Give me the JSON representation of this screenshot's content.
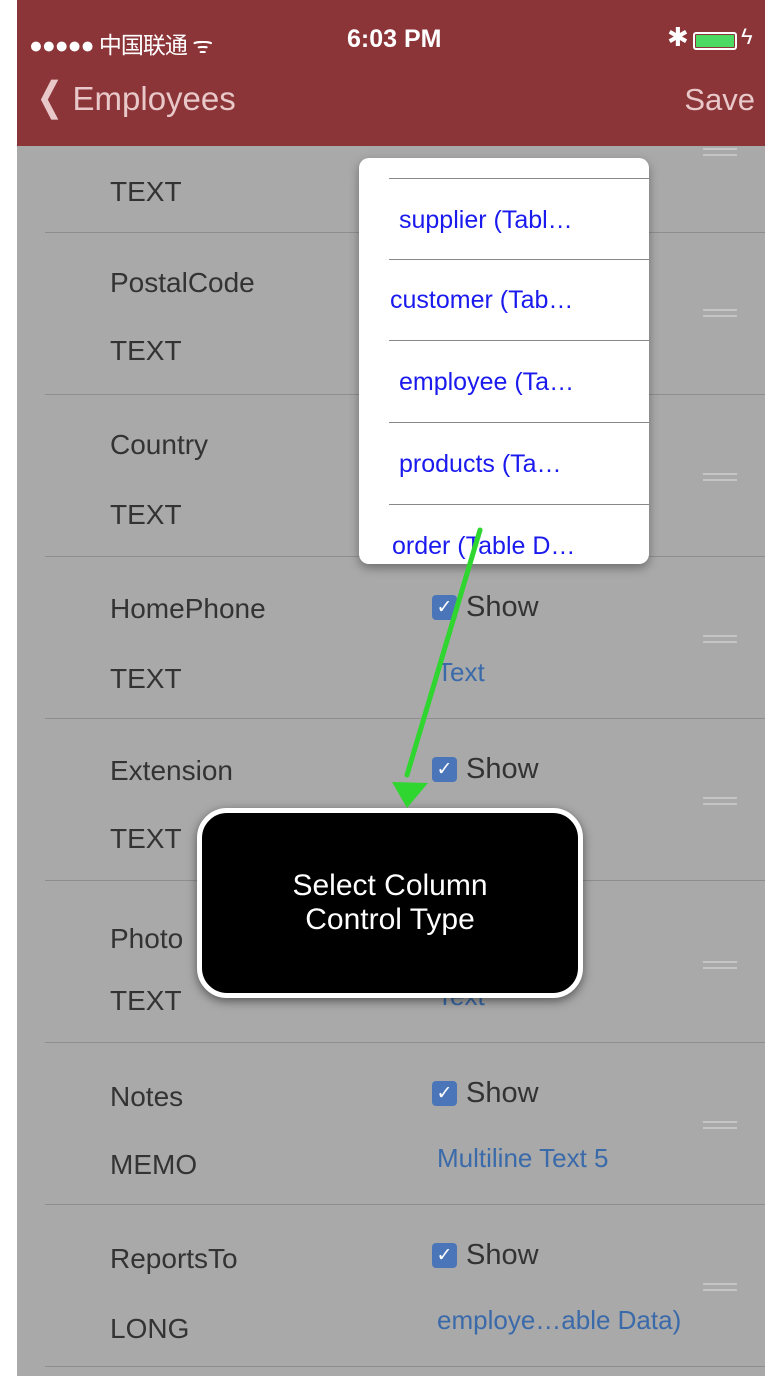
{
  "status": {
    "carrier": "●●●●● 中国联通 ᯤ",
    "time": "6:03 PM"
  },
  "nav": {
    "back_label": "Employees",
    "save_label": "Save"
  },
  "rows": [
    {
      "name": "",
      "type": "TEXT",
      "show": "",
      "control": ""
    },
    {
      "name": "PostalCode",
      "type": "TEXT",
      "show": "",
      "control": ""
    },
    {
      "name": "Country",
      "type": "TEXT",
      "show": "",
      "control": ""
    },
    {
      "name": "HomePhone",
      "type": "TEXT",
      "show": "Show",
      "control": "Text"
    },
    {
      "name": "Extension",
      "type": "TEXT",
      "show": "Show",
      "control": ""
    },
    {
      "name": "Photo",
      "type": "TEXT",
      "show": "",
      "control": "Text"
    },
    {
      "name": "Notes",
      "type": "MEMO",
      "show": "Show",
      "control": "Multiline Text 5"
    },
    {
      "name": "ReportsTo",
      "type": "LONG",
      "show": "Show",
      "control": "employe…able Data)"
    }
  ],
  "dropdown": {
    "options": [
      "supplier (Tabl…",
      "customer (Tab…",
      "employee (Ta…",
      "products  (Ta…",
      "order (Table D…"
    ]
  },
  "callout": {
    "line1": "Select Column",
    "line2": "Control Type"
  }
}
